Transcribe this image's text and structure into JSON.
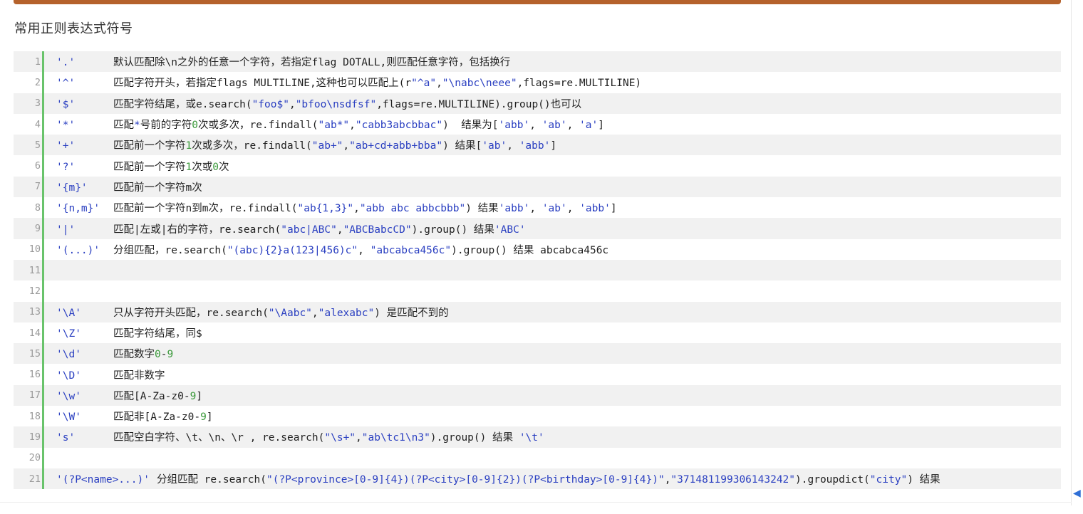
{
  "heading": "常用正则表达式符号",
  "lines": [
    {
      "n": "1",
      "sym": "'.'",
      "parts": [
        [
          "t",
          "默认匹配除\\n之外的任意一个字符，若指定flag DOTALL,则匹配任意字符，包括换行"
        ]
      ]
    },
    {
      "n": "2",
      "sym": "'^'",
      "parts": [
        [
          "t",
          "匹配字符开头，若指定flags MULTILINE,这种也可以匹配上(r"
        ],
        [
          "s",
          "\"^a\""
        ],
        [
          "t",
          ","
        ],
        [
          "s",
          "\"\\nabc\\neee\""
        ],
        [
          "t",
          ",flags=re.MULTILINE)"
        ]
      ]
    },
    {
      "n": "3",
      "sym": "'$'",
      "parts": [
        [
          "t",
          "匹配字符结尾，或e.search("
        ],
        [
          "s",
          "\"foo$\""
        ],
        [
          "t",
          ","
        ],
        [
          "s",
          "\"bfoo\\nsdfsf\""
        ],
        [
          "t",
          ",flags=re.MULTILINE).group()也可以"
        ]
      ]
    },
    {
      "n": "4",
      "sym": "'*'",
      "parts": [
        [
          "t",
          "匹配"
        ],
        [
          "s",
          "*"
        ],
        [
          "t",
          "号前的字符"
        ],
        [
          "n",
          "0"
        ],
        [
          "t",
          "次或多次，re.findall("
        ],
        [
          "s",
          "\"ab*\""
        ],
        [
          "t",
          ","
        ],
        [
          "s",
          "\"cabb3abcbbac\""
        ],
        [
          "t",
          ")  结果为["
        ],
        [
          "s",
          "'abb'"
        ],
        [
          "t",
          ", "
        ],
        [
          "s",
          "'ab'"
        ],
        [
          "t",
          ", "
        ],
        [
          "s",
          "'a'"
        ],
        [
          "t",
          "]"
        ]
      ]
    },
    {
      "n": "5",
      "sym": "'+'",
      "parts": [
        [
          "t",
          "匹配前一个字符"
        ],
        [
          "n",
          "1"
        ],
        [
          "t",
          "次或多次，re.findall("
        ],
        [
          "s",
          "\"ab+\""
        ],
        [
          "t",
          ","
        ],
        [
          "s",
          "\"ab+cd+abb+bba\""
        ],
        [
          "t",
          ") 结果["
        ],
        [
          "s",
          "'ab'"
        ],
        [
          "t",
          ", "
        ],
        [
          "s",
          "'abb'"
        ],
        [
          "t",
          "]"
        ]
      ]
    },
    {
      "n": "6",
      "sym": "'?'",
      "parts": [
        [
          "t",
          "匹配前一个字符"
        ],
        [
          "n",
          "1"
        ],
        [
          "t",
          "次或"
        ],
        [
          "n",
          "0"
        ],
        [
          "t",
          "次"
        ]
      ]
    },
    {
      "n": "7",
      "sym": "'{m}'",
      "parts": [
        [
          "t",
          "匹配前一个字符m次"
        ]
      ]
    },
    {
      "n": "8",
      "sym": "'{n,m}'",
      "parts": [
        [
          "t",
          "匹配前一个字符n到m次，re.findall("
        ],
        [
          "s",
          "\"ab{1,3}\""
        ],
        [
          "t",
          ","
        ],
        [
          "s",
          "\"abb abc abbcbbb\""
        ],
        [
          "t",
          ") 结果"
        ],
        [
          "s",
          "'abb'"
        ],
        [
          "t",
          ", "
        ],
        [
          "s",
          "'ab'"
        ],
        [
          "t",
          ", "
        ],
        [
          "s",
          "'abb'"
        ],
        [
          "t",
          "]"
        ]
      ]
    },
    {
      "n": "9",
      "sym": "'|'",
      "parts": [
        [
          "t",
          "匹配|左或|右的字符，re.search("
        ],
        [
          "s",
          "\"abc|ABC\""
        ],
        [
          "t",
          ","
        ],
        [
          "s",
          "\"ABCBabcCD\""
        ],
        [
          "t",
          ").group() 结果"
        ],
        [
          "s",
          "'ABC'"
        ]
      ]
    },
    {
      "n": "10",
      "sym": "'(...)'",
      "parts": [
        [
          "t",
          "分组匹配，re.search("
        ],
        [
          "s",
          "\"(abc){2}a(123|456)c\""
        ],
        [
          "t",
          ", "
        ],
        [
          "s",
          "\"abcabca456c\""
        ],
        [
          "t",
          ").group() 结果 abcabca456c"
        ]
      ]
    },
    {
      "n": "11",
      "sym": "",
      "parts": []
    },
    {
      "n": "12",
      "sym": "",
      "parts": []
    },
    {
      "n": "13",
      "sym": "'\\A'",
      "parts": [
        [
          "t",
          "只从字符开头匹配，re.search("
        ],
        [
          "s",
          "\"\\Aabc\""
        ],
        [
          "t",
          ","
        ],
        [
          "s",
          "\"alexabc\""
        ],
        [
          "t",
          ") 是匹配不到的"
        ]
      ]
    },
    {
      "n": "14",
      "sym": "'\\Z'",
      "parts": [
        [
          "t",
          "匹配字符结尾，同$"
        ]
      ]
    },
    {
      "n": "15",
      "sym": "'\\d'",
      "parts": [
        [
          "t",
          "匹配数字"
        ],
        [
          "n",
          "0"
        ],
        [
          "t",
          "-"
        ],
        [
          "n",
          "9"
        ]
      ]
    },
    {
      "n": "16",
      "sym": "'\\D'",
      "parts": [
        [
          "t",
          "匹配非数字"
        ]
      ]
    },
    {
      "n": "17",
      "sym": "'\\w'",
      "parts": [
        [
          "t",
          "匹配[A-Za-z0-"
        ],
        [
          "n",
          "9"
        ],
        [
          "t",
          "]"
        ]
      ]
    },
    {
      "n": "18",
      "sym": "'\\W'",
      "parts": [
        [
          "t",
          "匹配非[A-Za-z0-"
        ],
        [
          "n",
          "9"
        ],
        [
          "t",
          "]"
        ]
      ]
    },
    {
      "n": "19",
      "sym": "'s'",
      "parts": [
        [
          "t",
          "匹配空白字符、\\t、\\n、\\r , re.search("
        ],
        [
          "s",
          "\"\\s+\""
        ],
        [
          "t",
          ","
        ],
        [
          "s",
          "\"ab\\tc1\\n3\""
        ],
        [
          "t",
          ").group() 结果 "
        ],
        [
          "s",
          "'\\t'"
        ]
      ]
    },
    {
      "n": "20",
      "sym": "",
      "parts": []
    },
    {
      "n": "21",
      "sym": "'(?P<name>...)'",
      "wide": true,
      "parts": [
        [
          "t",
          "分组匹配 re.search("
        ],
        [
          "s",
          "\"(?P<province>[0-9]{4})(?P<city>[0-9]{2})(?P<birthday>[0-9]{4})\""
        ],
        [
          "t",
          ","
        ],
        [
          "s",
          "\"371481199306143242\""
        ],
        [
          "t",
          ").groupdict("
        ],
        [
          "s",
          "\"city\""
        ],
        [
          "t",
          ") 结果"
        ]
      ]
    }
  ]
}
